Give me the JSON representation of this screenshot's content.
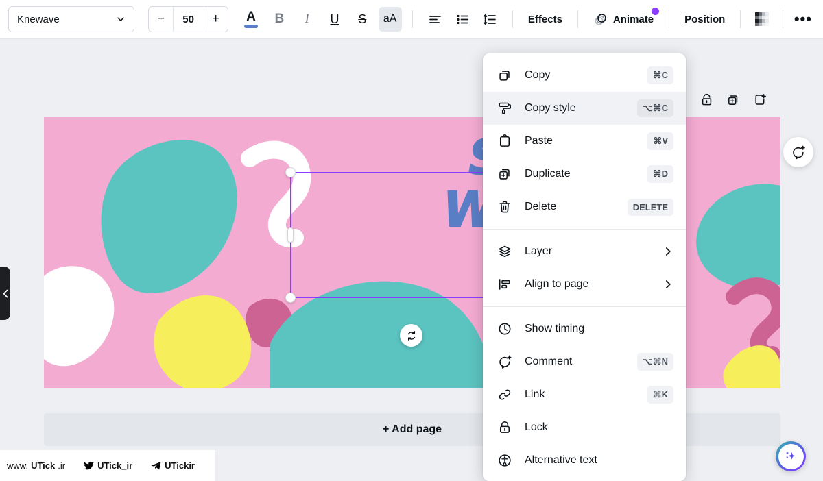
{
  "toolbar": {
    "font_name": "Knewave",
    "font_size": "50",
    "decrease_label": "−",
    "increase_label": "+",
    "font_color_glyph": "A",
    "font_color_hex": "#5a7ec6",
    "bold_label": "B",
    "italic_label": "I",
    "underline_label": "U",
    "strikethrough_label": "S",
    "case_label": "aA",
    "effects_label": "Effects",
    "animate_label": "Animate",
    "position_label": "Position",
    "more_label": "•••"
  },
  "page_tools": {
    "lock": "lock-icon",
    "duplicate": "duplicate-page-icon",
    "add": "add-page-icon"
  },
  "canvas": {
    "background_hex": "#f4abd2",
    "teal_hex": "#5cc4c0",
    "yellow_hex": "#f7ee5c",
    "rose_hex": "#cc6392",
    "white_hex": "#ffffff",
    "text_line1": "STAY",
    "text_line2": "WEIRD",
    "text_color_hex": "#5a7ec6",
    "selection_color_hex": "#8b3dff"
  },
  "add_page_label": "+ Add page",
  "context_menu": {
    "groups": [
      {
        "items": [
          {
            "label": "Copy",
            "shortcut": "⌘C",
            "icon": "copy-icon",
            "arrow": false,
            "highlight": false
          },
          {
            "label": "Copy style",
            "shortcut": "⌥⌘C",
            "icon": "paint-roller-icon",
            "arrow": false,
            "highlight": true
          },
          {
            "label": "Paste",
            "shortcut": "⌘V",
            "icon": "clipboard-icon",
            "arrow": false,
            "highlight": false
          },
          {
            "label": "Duplicate",
            "shortcut": "⌘D",
            "icon": "duplicate-icon",
            "arrow": false,
            "highlight": false
          },
          {
            "label": "Delete",
            "shortcut": "DELETE",
            "icon": "trash-icon",
            "arrow": false,
            "highlight": false
          }
        ]
      },
      {
        "items": [
          {
            "label": "Layer",
            "shortcut": "",
            "icon": "layers-icon",
            "arrow": true,
            "highlight": false
          },
          {
            "label": "Align to page",
            "shortcut": "",
            "icon": "align-icon",
            "arrow": true,
            "highlight": false
          }
        ]
      },
      {
        "items": [
          {
            "label": "Show timing",
            "shortcut": "",
            "icon": "clock-icon",
            "arrow": false,
            "highlight": false
          },
          {
            "label": "Comment",
            "shortcut": "⌥⌘N",
            "icon": "comment-plus-icon",
            "arrow": false,
            "highlight": false
          },
          {
            "label": "Link",
            "shortcut": "⌘K",
            "icon": "link-icon",
            "arrow": false,
            "highlight": false
          },
          {
            "label": "Lock",
            "shortcut": "",
            "icon": "lock-icon",
            "arrow": false,
            "highlight": false
          },
          {
            "label": "Alternative text",
            "shortcut": "",
            "icon": "accessibility-icon",
            "arrow": false,
            "highlight": false
          }
        ]
      }
    ]
  },
  "watermark": {
    "site": "www.",
    "site_bold": "UTick",
    "site_tld": ".ir",
    "twitter": "UTick_ir",
    "telegram": "UTickir"
  }
}
